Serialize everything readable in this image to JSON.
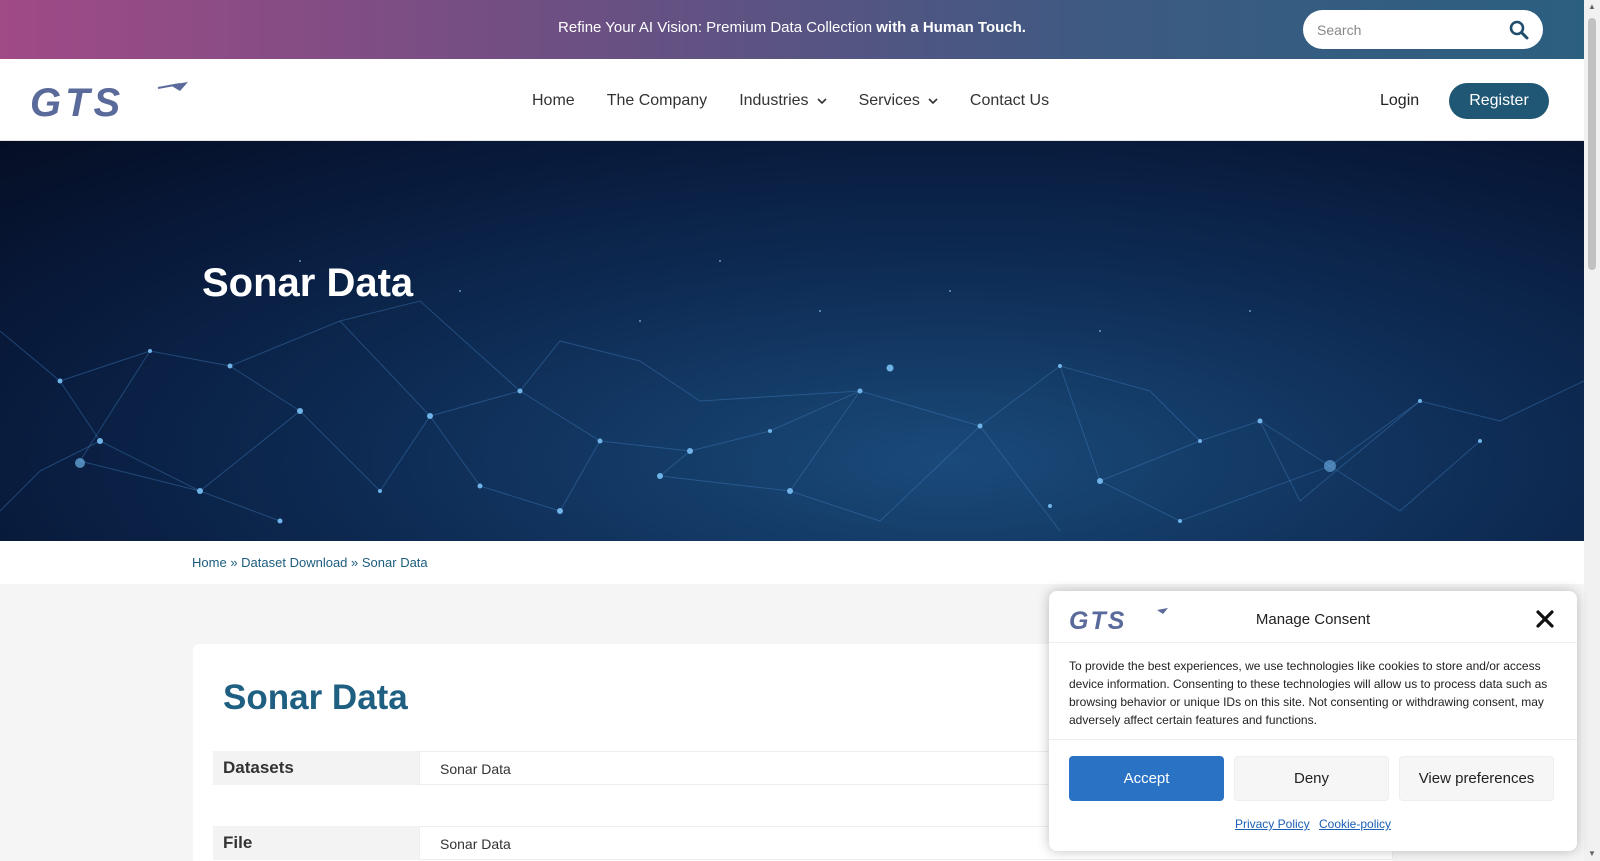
{
  "topbar": {
    "text_regular": "Refine Your AI Vision: Premium Data Collection ",
    "text_bold": "with a Human Touch.",
    "search_placeholder": "Search"
  },
  "brand": {
    "logo_text": "GTS",
    "accent": "#205774",
    "logo_color": "#5a6a9a"
  },
  "nav": {
    "items": [
      "Home",
      "The Company",
      "Industries",
      "Services",
      "Contact Us"
    ],
    "login": "Login",
    "register": "Register"
  },
  "hero": {
    "title": "Sonar Data"
  },
  "breadcrumb": {
    "home": "Home",
    "sep": "»",
    "parent": "Dataset Download",
    "current": "Sonar Data"
  },
  "card": {
    "title": "Sonar Data",
    "rows": [
      {
        "label": "Datasets",
        "value": "Sonar Data"
      },
      {
        "label": "File",
        "value": "Sonar Data"
      }
    ]
  },
  "consent": {
    "title": "Manage Consent",
    "text": "To provide the best experiences, we use technologies like cookies to store and/or access device information. Consenting to these technologies will allow us to process data such as browsing behavior or unique IDs on this site. Not consenting or withdrawing consent, may adversely affect certain features and functions.",
    "accept": "Accept",
    "deny": "Deny",
    "view_preferences": "View preferences",
    "privacy_policy": "Privacy Policy",
    "cookie_policy": "Cookie-policy",
    "accept_color": "#2a73c4"
  }
}
